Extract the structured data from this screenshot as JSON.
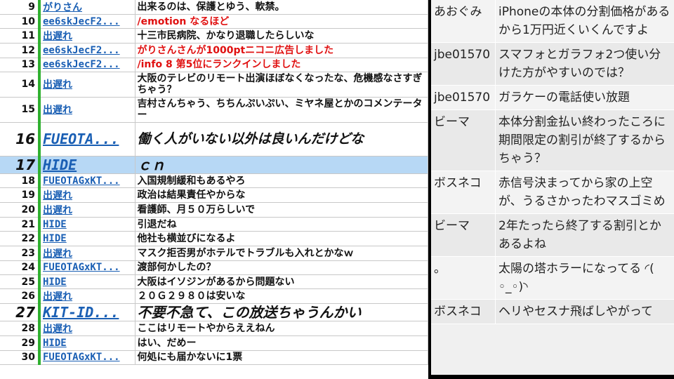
{
  "left_comments": [
    {
      "no": "9",
      "user": "がりさん",
      "text": "出来るのは、保護とゆう、軟禁。",
      "style": ""
    },
    {
      "no": "10",
      "user": "ee6skJecF2...",
      "text": "/emotion なるほど",
      "style": "red"
    },
    {
      "no": "11",
      "user": "出遅れ",
      "text": "十三市民病院、かなり退職したらしいな",
      "style": ""
    },
    {
      "no": "12",
      "user": "ee6skJecF2...",
      "text": "がりさんさんが1000ptニコニ広告しました",
      "style": "red"
    },
    {
      "no": "13",
      "user": "ee6skJecF2...",
      "text": "/info 8 第5位にランクインしました",
      "style": "red"
    },
    {
      "no": "14",
      "user": "出遅れ",
      "text": "大阪のテレビのリモート出演ほぼなくなったな、危機感なさすぎちゃう？",
      "style": "tall"
    },
    {
      "no": "15",
      "user": "出遅れ",
      "text": "吉村さんちゃう、ちちんぷいぷい、ミヤネ屋とかのコメンテーター",
      "style": "tall"
    },
    {
      "no": "16",
      "user": "FUEOTA...",
      "text": "働く人がいない以外は良いんだけどな",
      "style": "big"
    },
    {
      "no": "17",
      "user": "HIDE",
      "text": "ｃｎ",
      "style": "large sel"
    },
    {
      "no": "18",
      "user": "FUEOTAGxKT...",
      "text": "入国規制緩和もあるやろ",
      "style": ""
    },
    {
      "no": "19",
      "user": "出遅れ",
      "text": "政治は結果責任やからな",
      "style": ""
    },
    {
      "no": "20",
      "user": "出遅れ",
      "text": "看護師、月５０万らしいで",
      "style": ""
    },
    {
      "no": "21",
      "user": "HIDE",
      "text": "引退だね",
      "style": ""
    },
    {
      "no": "22",
      "user": "HIDE",
      "text": "他社も横並びになるよ",
      "style": ""
    },
    {
      "no": "23",
      "user": "出遅れ",
      "text": "マスク拒否男がホテルでトラブルも入れとかなｗ",
      "style": ""
    },
    {
      "no": "24",
      "user": "FUEOTAGxKT...",
      "text": "渡部何かしたの？",
      "style": ""
    },
    {
      "no": "25",
      "user": "HIDE",
      "text": "大阪はイソジンがあるから問題ない",
      "style": ""
    },
    {
      "no": "26",
      "user": "出遅れ",
      "text": "２０Ｇ２９８０は安いな",
      "style": ""
    },
    {
      "no": "27",
      "user": "KIT-ID...",
      "text": "不要不急て、この放送ちゃうんかい",
      "style": "large"
    },
    {
      "no": "28",
      "user": "出遅れ",
      "text": "ここはリモートやからええねん",
      "style": ""
    },
    {
      "no": "29",
      "user": "HIDE",
      "text": "はい、だめー",
      "style": ""
    },
    {
      "no": "30",
      "user": "FUEOTAGxKT...",
      "text": "何処にも届かないに1票",
      "style": ""
    }
  ],
  "right_comments": [
    {
      "name": "あおぐみ",
      "text": "iPhoneの本体の分割価格があるから1万円近くいくんですよ"
    },
    {
      "name": "jbe01570",
      "text": "スマフォとガラフォ2つ使い分けた方がやすいのでは？"
    },
    {
      "name": "jbe01570",
      "text": "ガラケーの電話使い放題"
    },
    {
      "name": "ビーマ",
      "text": "本体分割金払い終わったころに期間限定の割引が終了するからちゃう？"
    },
    {
      "name": "ボスネコ",
      "text": "赤信号決まってから家の上空が、うるさかったわマスゴミめ"
    },
    {
      "name": "ビーマ",
      "text": "2年たったら終了する割引とかあるよね"
    },
    {
      "name": "。",
      "text": "太陽の塔ホラーになってる ◜( ◦_◦)◝"
    },
    {
      "name": "ボスネコ",
      "text": "ヘリやセスナ飛ばしやがって"
    }
  ]
}
